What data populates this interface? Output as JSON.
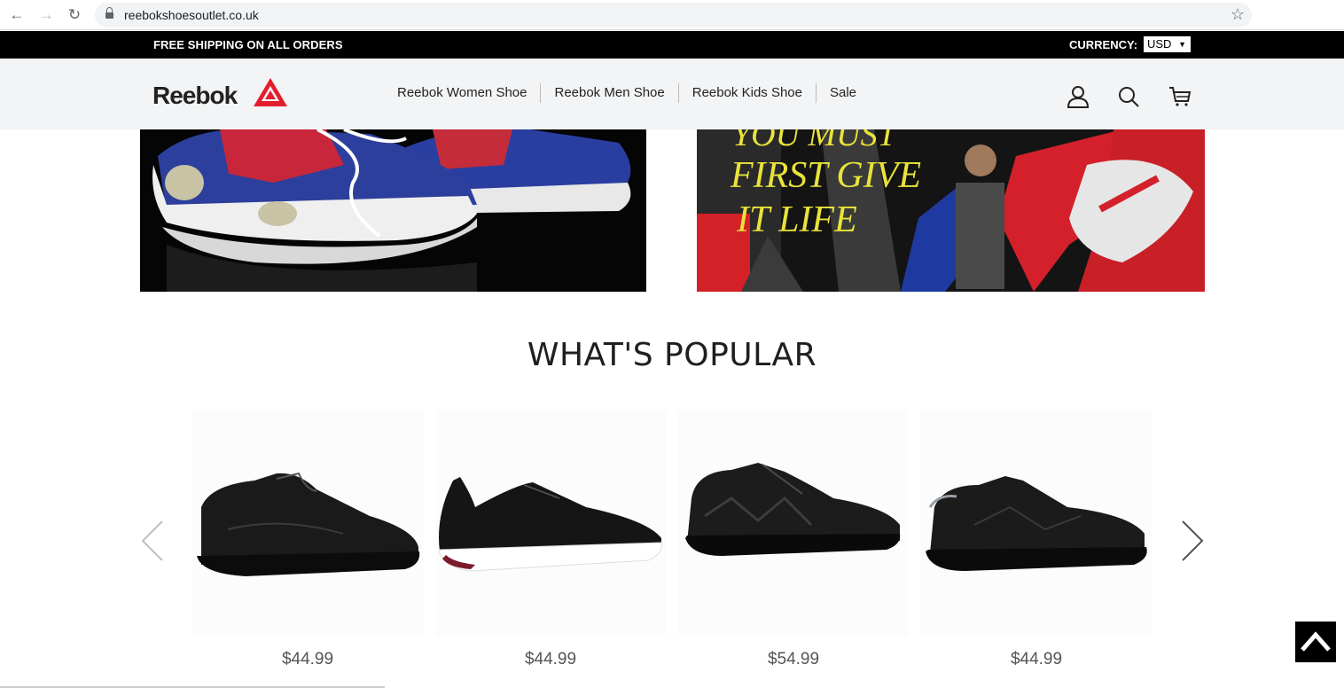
{
  "browser": {
    "url": "reebokshoesoutlet.co.uk"
  },
  "topbar": {
    "shipping": "FREE SHIPPING ON ALL ORDERS",
    "currency_label": "CURRENCY:",
    "currency_value": "USD"
  },
  "header": {
    "logo_text": "Reebok",
    "nav": [
      "Reebok Women Shoe",
      "Reebok Men Shoe",
      "Reebok Kids Shoe",
      "Sale"
    ]
  },
  "banners": {
    "right_text_1": "YOU MUST",
    "right_text_2": "FIRST GIVE",
    "right_text_3": "IT LIFE"
  },
  "popular": {
    "title": "WHAT'S POPULAR",
    "products": [
      {
        "price": "$44.99"
      },
      {
        "price": "$44.99"
      },
      {
        "price": "$54.99"
      },
      {
        "price": "$44.99"
      }
    ]
  },
  "colors": {
    "brand_red": "#e41d2d",
    "topbar_bg": "#000000",
    "header_bg": "#f3f4f5"
  }
}
